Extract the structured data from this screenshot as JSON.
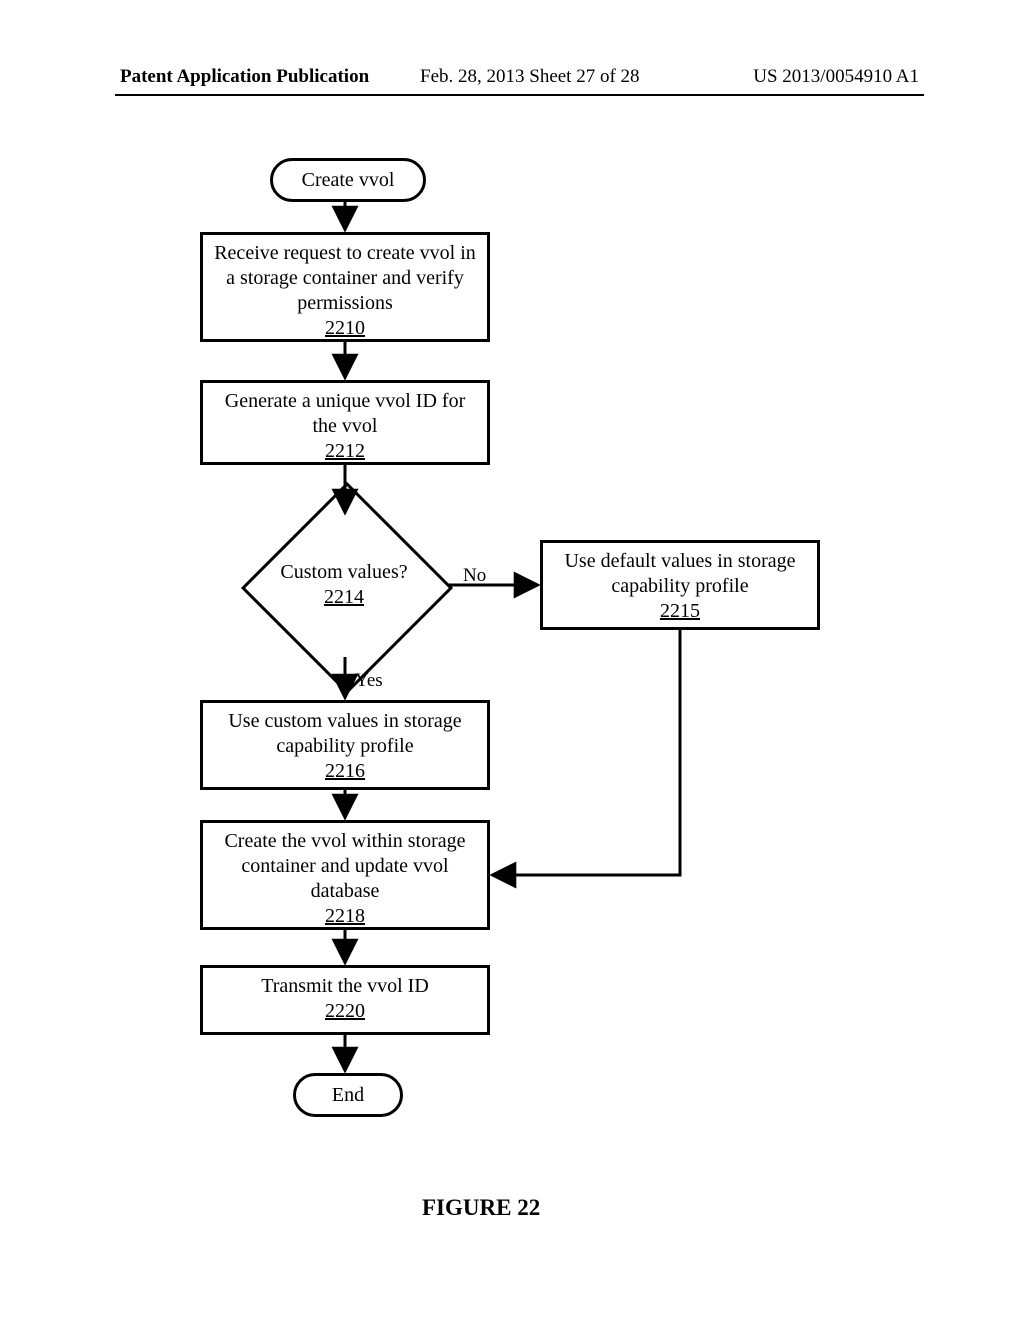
{
  "header": {
    "left": "Patent Application Publication",
    "mid": "Feb. 28, 2013  Sheet 27 of 28",
    "right": "US 2013/0054910 A1"
  },
  "terminators": {
    "start": "Create vvol",
    "end": "End"
  },
  "steps": {
    "s2210": {
      "text": "Receive request to create vvol in a storage container and verify permissions",
      "ref": "2210"
    },
    "s2212": {
      "text": "Generate a unique vvol ID for the vvol",
      "ref": "2212"
    },
    "s2214": {
      "text": "Custom values?",
      "ref": "2214"
    },
    "s2215": {
      "text": "Use default values in storage capability profile",
      "ref": "2215"
    },
    "s2216": {
      "text": "Use custom values in storage capability profile",
      "ref": "2216"
    },
    "s2218": {
      "text": "Create the vvol within storage container and update vvol database",
      "ref": "2218"
    },
    "s2220": {
      "text": "Transmit the vvol ID",
      "ref": "2220"
    }
  },
  "edge_labels": {
    "no": "No",
    "yes": "Yes"
  },
  "figure_caption": "FIGURE 22"
}
